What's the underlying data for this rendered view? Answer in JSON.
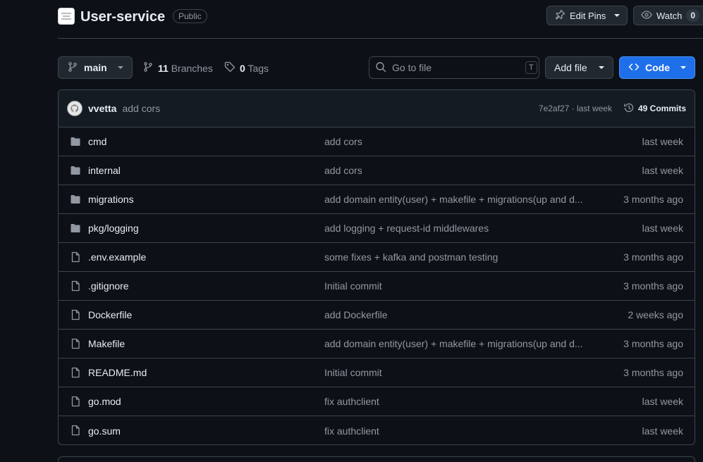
{
  "repo": {
    "title": "User-service",
    "visibility": "Public"
  },
  "header_buttons": {
    "edit_pins": "Edit Pins",
    "watch": "Watch",
    "watch_count": "0"
  },
  "toolbar": {
    "branch": "main",
    "branches_count": "11",
    "branches_label": "Branches",
    "tags_count": "0",
    "tags_label": "Tags",
    "search_placeholder": "Go to file",
    "search_shortcut": "T",
    "add_file": "Add file",
    "code": "Code"
  },
  "latest_commit": {
    "author": "vvetta",
    "message": "add cors",
    "hash_time": "7e2af27 · last week",
    "commits": "49 Commits"
  },
  "files": [
    {
      "name": "cmd",
      "type": "folder",
      "message": "add cors",
      "date": "last week"
    },
    {
      "name": "internal",
      "type": "folder",
      "message": "add cors",
      "date": "last week"
    },
    {
      "name": "migrations",
      "type": "folder",
      "message": "add domain entity(user) + makefile + migrations(up and d...",
      "date": "3 months ago"
    },
    {
      "name": "pkg/logging",
      "type": "folder",
      "message": "add logging + request-id middlewares",
      "date": "last week"
    },
    {
      "name": ".env.example",
      "type": "file",
      "message": "some fixes + kafka and postman testing",
      "date": "3 months ago"
    },
    {
      "name": ".gitignore",
      "type": "file",
      "message": "Initial commit",
      "date": "3 months ago"
    },
    {
      "name": "Dockerfile",
      "type": "file",
      "message": "add Dockerfile",
      "date": "2 weeks ago"
    },
    {
      "name": "Makefile",
      "type": "file",
      "message": "add domain entity(user) + makefile + migrations(up and d...",
      "date": "3 months ago"
    },
    {
      "name": "README.md",
      "type": "file",
      "message": "Initial commit",
      "date": "3 months ago"
    },
    {
      "name": "go.mod",
      "type": "file",
      "message": "fix authclient",
      "date": "last week"
    },
    {
      "name": "go.sum",
      "type": "file",
      "message": "fix authclient",
      "date": "last week"
    }
  ]
}
